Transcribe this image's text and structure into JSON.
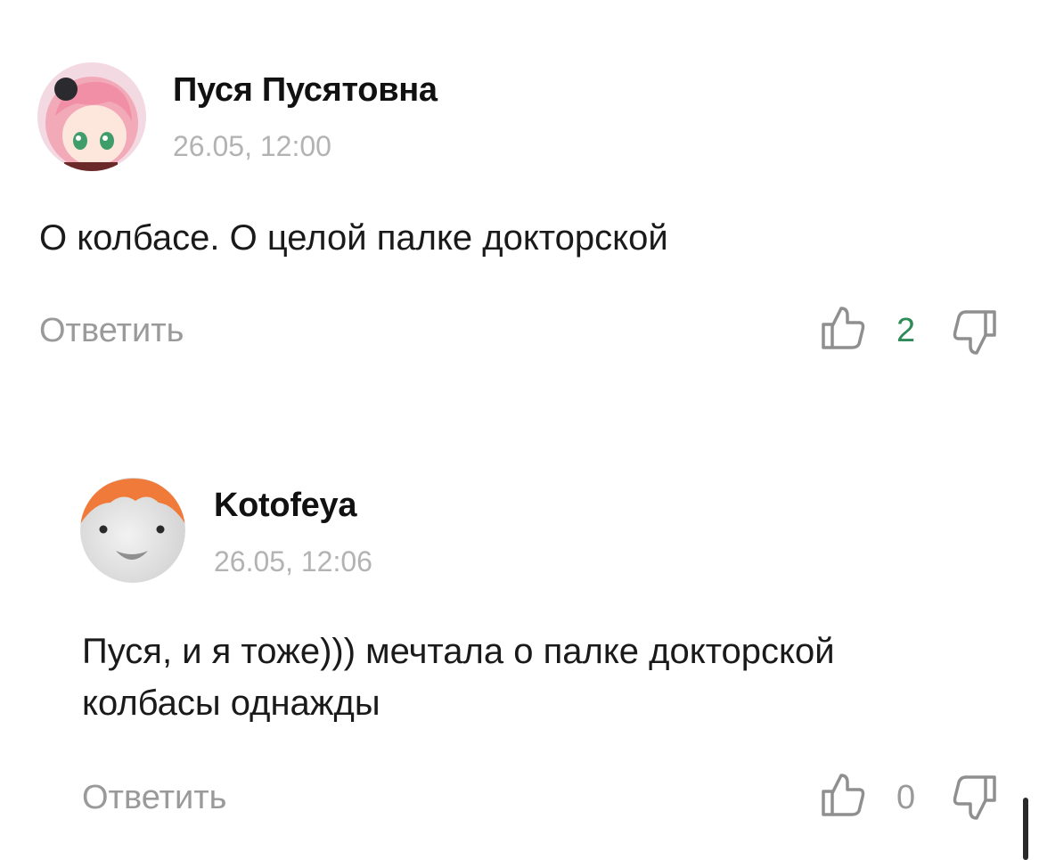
{
  "comments": [
    {
      "author": "Пуся Пусятовна",
      "time": "26.05, 12:00",
      "text": "О колбасе. О целой палке докторской",
      "reply_label": "Ответить",
      "likes": "2",
      "likes_color": "#2e8b57"
    },
    {
      "author": "Kotofeya",
      "time": "26.05, 12:06",
      "text": "Пуся, и я тоже))) мечтала о палке докторской колбасы однажды",
      "reply_label": "Ответить",
      "likes": "0",
      "likes_color": "#9a9a9a"
    }
  ],
  "icons": {
    "like": "thumb-up-icon",
    "dislike": "thumb-down-icon"
  },
  "colors": {
    "muted": "#9a9a9a",
    "timestamp": "#b3b3b3",
    "positive": "#2e8b57",
    "avatar_hair": "#f07a3a"
  }
}
